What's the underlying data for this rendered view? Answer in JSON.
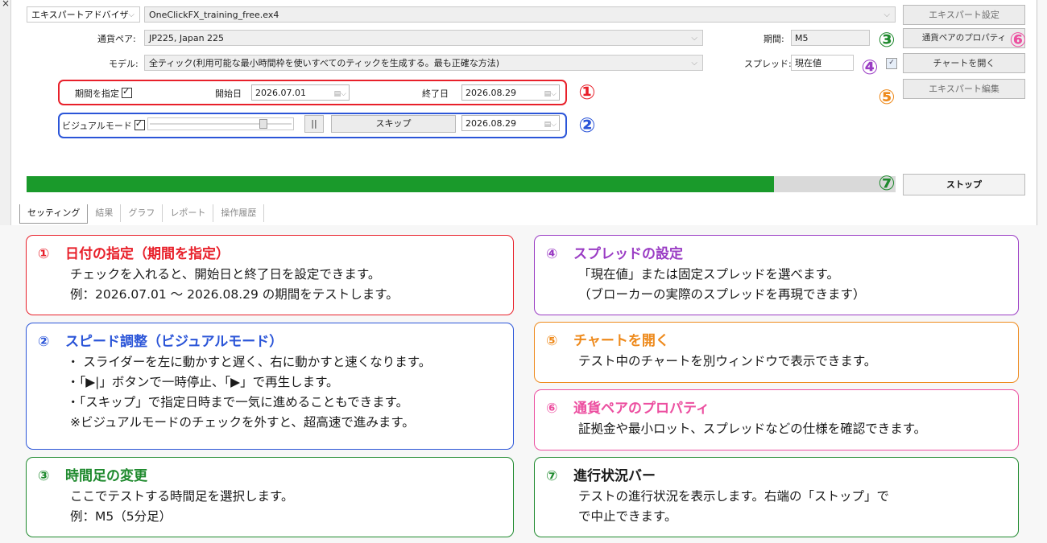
{
  "colors": {
    "red": "#e8202a",
    "blue": "#2b55d8",
    "green": "#1f8a2e",
    "purple": "#9a3cc4",
    "orange": "#ee8a1c",
    "pink": "#ec4fa0",
    "progress": "#1a9a2b"
  },
  "tester": {
    "close_glyph": "×",
    "type_combo": "エキスパートアドバイザ",
    "ea_file": "OneClickFX_training_free.ex4",
    "symbol_label": "通貨ペア:",
    "symbol_value": "JP225, Japan 225",
    "model_label": "モデル:",
    "model_value": "全ティック(利用可能な最小時間枠を使いすべてのティックを生成する。最も正確な方法)",
    "period_label": "期間:",
    "period_value": "M5",
    "spread_label": "スプレッド:",
    "spread_value": "現在値",
    "use_date_label": "期間を指定",
    "start_label": "開始日",
    "start_value": "2026.07.01",
    "end_label": "終了日",
    "end_value": "2026.08.29",
    "visual_label": "ビジュアルモード",
    "pause_label": "||",
    "skip_label": "スキップ",
    "skip_to_value": "2026.08.29",
    "visual_speed_fraction": 0.82,
    "progress_fraction": 0.86,
    "buttons": {
      "expert_settings": "エキスパート設定",
      "symbol_properties": "通貨ペアのプロパティ",
      "open_chart": "チャートを開く",
      "modify_expert": "エキスパート編集",
      "stop": "ストップ"
    },
    "tabs": [
      "セッティング",
      "結果",
      "グラフ",
      "レポート",
      "操作履歴"
    ],
    "markers": [
      "①",
      "②",
      "③",
      "④",
      "⑤",
      "⑥",
      "⑦"
    ]
  },
  "cards": [
    {
      "num": "①",
      "title": "日付の指定（期間を指定）",
      "lines": [
        "チェックを入れると、開始日と終了日を設定できます。",
        "例：2026.07.01 ～ 2026.08.29 の期間をテストします。"
      ]
    },
    {
      "num": "②",
      "title": "スピード調整（ビジュアルモード）",
      "lines": [
        "・ スライダーを左に動かすと遅く、右に動かすと速くなります。",
        "・「▶|」ボタンで一時停止、「▶」で再生します。",
        "・「スキップ」で指定日時まで一気に進めることもできます。",
        "※ビジュアルモードのチェックを外すと、超高速で進みます。"
      ]
    },
    {
      "num": "③",
      "title": "時間足の変更",
      "lines": [
        "ここでテストする時間足を選択します。",
        " 例：M5（5分足）"
      ]
    },
    {
      "num": "④",
      "title": "スプレッドの設定",
      "lines": [
        "「現在値」または固定スプレッドを選べます。",
        "（ブローカーの実際のスプレッドを再現できます）"
      ]
    },
    {
      "num": "⑤",
      "title": "チャートを開く",
      "lines": [
        "テスト中のチャートを別ウィンドウで表示できます。"
      ]
    },
    {
      "num": "⑥",
      "title": "通貨ペアのプロパティ",
      "lines": [
        "証拠金や最小ロット、スプレッドなどの仕様を確認できます。"
      ]
    },
    {
      "num": "⑦",
      "title": "進行状況バー",
      "lines": [
        "テストの進行状況を表示します。右端の「ストップ」で",
        "で中止できます。"
      ]
    }
  ]
}
